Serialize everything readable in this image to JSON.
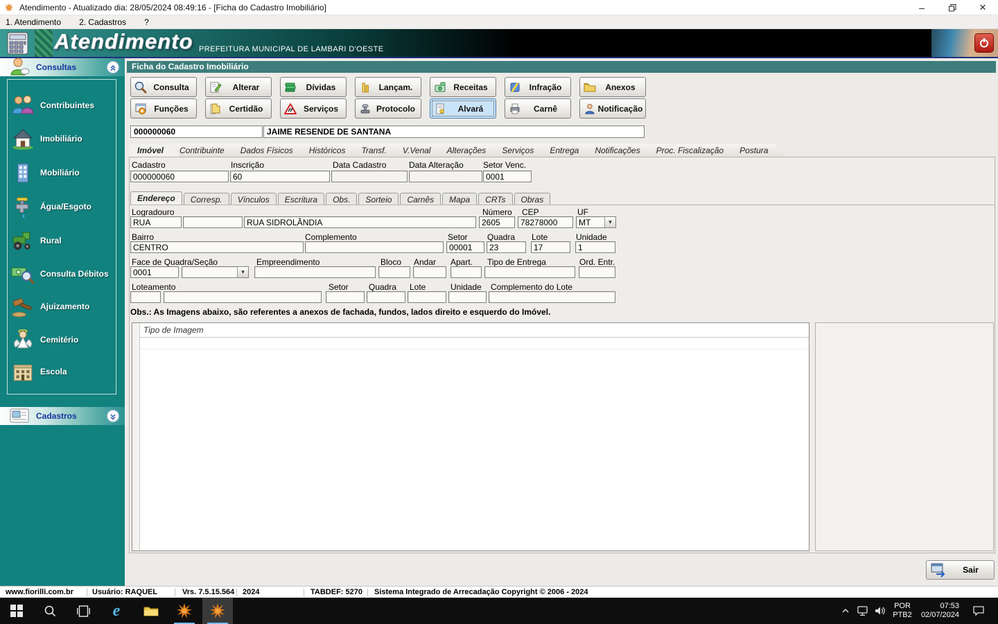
{
  "titlebar": {
    "title": "Atendimento - Atualizado dia: 28/05/2024 08:49:16 - [Ficha do Cadastro Imobiliário]"
  },
  "menubar": {
    "items": [
      "1. Atendimento",
      "2. Cadastros",
      "?"
    ]
  },
  "banner": {
    "app": "Atendimento",
    "muni": "PREFEITURA MUNICIPAL DE LAMBARI D'OESTE"
  },
  "sidebar": {
    "consultas": "Consultas",
    "cadastros": "Cadastros",
    "items": [
      "Contribuintes",
      "Imobiliário",
      "Mobiliário",
      "Água/Esgoto",
      "Rural",
      "Consulta Débitos",
      "Ajuizamento",
      "Cemitério",
      "Escola"
    ]
  },
  "panel": {
    "title": "Ficha do Cadastro Imobiliário"
  },
  "toolbar": {
    "row1": [
      "Consulta",
      "Alterar",
      "Dívidas",
      "Lançam.",
      "Receitas",
      "Infração",
      "Anexos"
    ],
    "row2": [
      "Funções",
      "Certidão",
      "Serviços",
      "Protocolo",
      "Alvará",
      "Carnê",
      "Notificação"
    ]
  },
  "record": {
    "code": "000000060",
    "name": "JAIME RESENDE DE SANTANA"
  },
  "tabs": [
    "Imóvel",
    "Contribuinte",
    "Dados Físicos",
    "Históricos",
    "Transf.",
    "V.Venal",
    "Alterações",
    "Serviços",
    "Entrega",
    "Notificações",
    "Proc. Fiscalização",
    "Postura"
  ],
  "fields": {
    "cadastro": {
      "label": "Cadastro",
      "value": "000000060"
    },
    "inscricao": {
      "label": "Inscrição",
      "value": "60"
    },
    "data_cadastro": {
      "label": "Data Cadastro",
      "value": ""
    },
    "data_alteracao": {
      "label": "Data Alteração",
      "value": ""
    },
    "setor_venc": {
      "label": "Setor Venc.",
      "value": "0001"
    }
  },
  "subtabs": [
    "Endereço",
    "Corresp.",
    "Vínculos",
    "Escritura",
    "Obs.",
    "Sorteio",
    "Carnês",
    "Mapa",
    "CRTs",
    "Obras"
  ],
  "endereco": {
    "logradouro_label": "Logradouro",
    "logradouro_tipo": "RUA",
    "logradouro_compl": "",
    "logradouro_nome": "RUA SIDROLÂNDIA",
    "numero_label": "Número",
    "numero": "2605",
    "cep_label": "CEP",
    "cep": "78278000",
    "uf_label": "UF",
    "uf": "MT",
    "bairro_label": "Bairro",
    "bairro": "CENTRO",
    "complemento_label": "Complemento",
    "complemento": "",
    "setor_label": "Setor",
    "setor": "00001",
    "quadra_label": "Quadra",
    "quadra": "23",
    "lote_label": "Lote",
    "lote": "17",
    "unidade_label": "Unidade",
    "unidade": "1",
    "face_label": "Face de Quadra/Seção",
    "face": "0001",
    "face_combo": "",
    "empreendimento_label": "Empreendimento",
    "empreendimento": "",
    "bloco_label": "Bloco",
    "bloco": "",
    "andar_label": "Andar",
    "andar": "",
    "apart_label": "Apart.",
    "apart": "",
    "tipo_entrega_label": "Tipo de Entrega",
    "tipo_entrega": "",
    "ord_entr_label": "Ord. Entr.",
    "ord_entr": "",
    "loteamento_label": "Loteamento",
    "loteamento_cod": "",
    "loteamento_nome": "",
    "lot_setor_label": "Setor",
    "lot_setor": "",
    "lot_quadra_label": "Quadra",
    "lot_quadra": "",
    "lot_lote_label": "Lote",
    "lot_lote": "",
    "lot_unidade_label": "Unidade",
    "lot_unidade": "",
    "compl_lote_label": "Complemento do Lote",
    "compl_lote": ""
  },
  "obs": "Obs.: As Imagens abaixo, são referentes a anexos de fachada, fundos, lados direito e esquerdo do Imóvel.",
  "grid": {
    "col": "Tipo de Imagem"
  },
  "footer": {
    "sair": "Sair"
  },
  "statusbar": {
    "site": "www.fiorilli.com.br",
    "user": "Usuário: RAQUEL",
    "version": "Vrs. 7.5.15.564",
    "year": "2024",
    "tabdef": "TABDEF: 5270",
    "copyright": "Sistema Integrado de Arrecadação Copyright © 2006 - 2024"
  },
  "tray": {
    "lang1": "POR",
    "lang2": "PTB2",
    "time": "07:53",
    "date": "02/07/2024"
  }
}
